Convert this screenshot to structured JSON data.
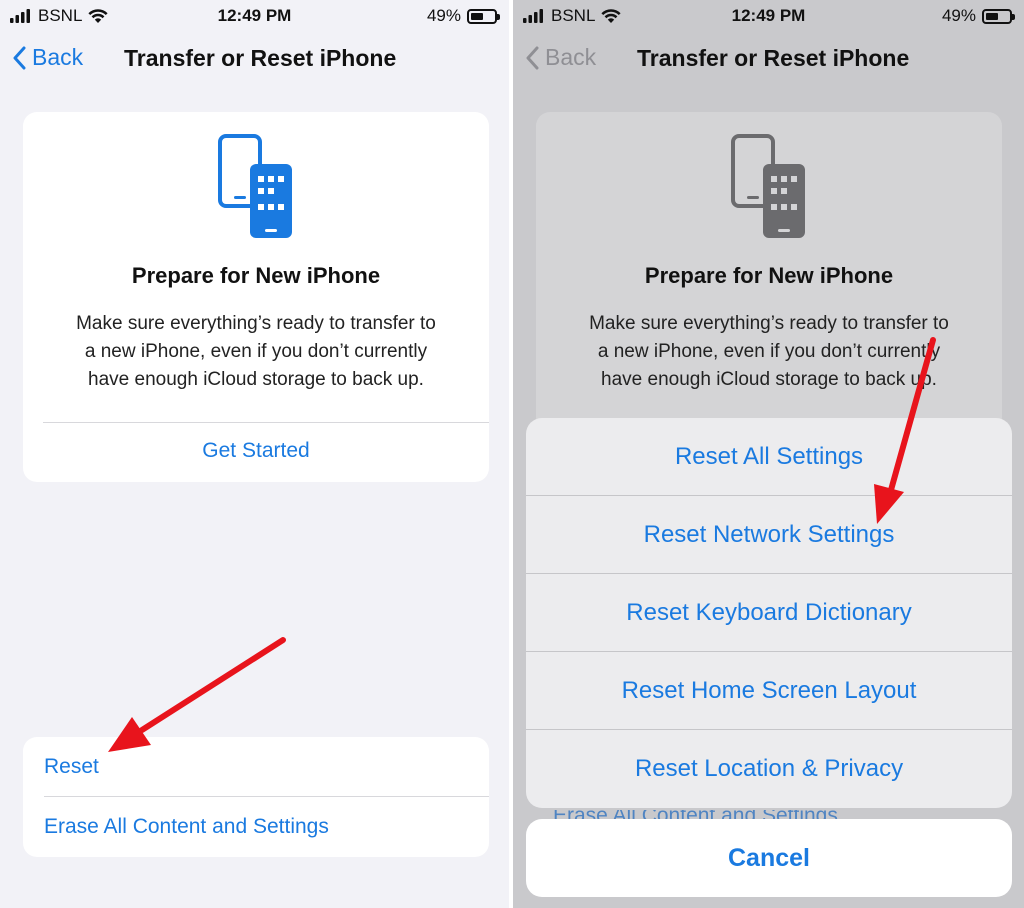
{
  "left": {
    "status": {
      "carrier": "BSNL",
      "time": "12:49 PM",
      "battery": "49%",
      "battery_level": 0.49
    },
    "nav": {
      "back_label": "Back",
      "title": "Transfer or Reset iPhone"
    },
    "prepare_card": {
      "icon": "two-phones-icon",
      "title": "Prepare for New iPhone",
      "description_lines": [
        "Make sure everything’s ready to transfer to",
        "a new iPhone, even if you don’t currently",
        "have enough iCloud storage to back up."
      ],
      "action": "Get Started"
    },
    "reset_options": [
      "Reset",
      "Erase All Content and Settings"
    ]
  },
  "right": {
    "status": {
      "carrier": "BSNL",
      "time": "12:49 PM",
      "battery": "49%",
      "battery_level": 0.49
    },
    "nav": {
      "back_label": "Back",
      "title": "Transfer or Reset iPhone"
    },
    "prepare_card": {
      "icon": "two-phones-icon",
      "title": "Prepare for New iPhone",
      "description_lines": [
        "Make sure everything’s ready to transfer to",
        "a new iPhone, even if you don’t currently",
        "have enough iCloud storage to back up."
      ]
    },
    "action_sheet": {
      "items": [
        "Reset All Settings",
        "Reset Network Settings",
        "Reset Keyboard Dictionary",
        "Reset Home Screen Layout",
        "Reset Location & Privacy"
      ],
      "cancel": "Cancel"
    },
    "obscured_row": "Erase All Content and Settings"
  },
  "colors": {
    "ios_blue": "#1a7ae0",
    "arrow_red": "#e8141c",
    "grouped_bg": "#f2f2f7",
    "dimmed_bg": "#c9c9cc"
  }
}
